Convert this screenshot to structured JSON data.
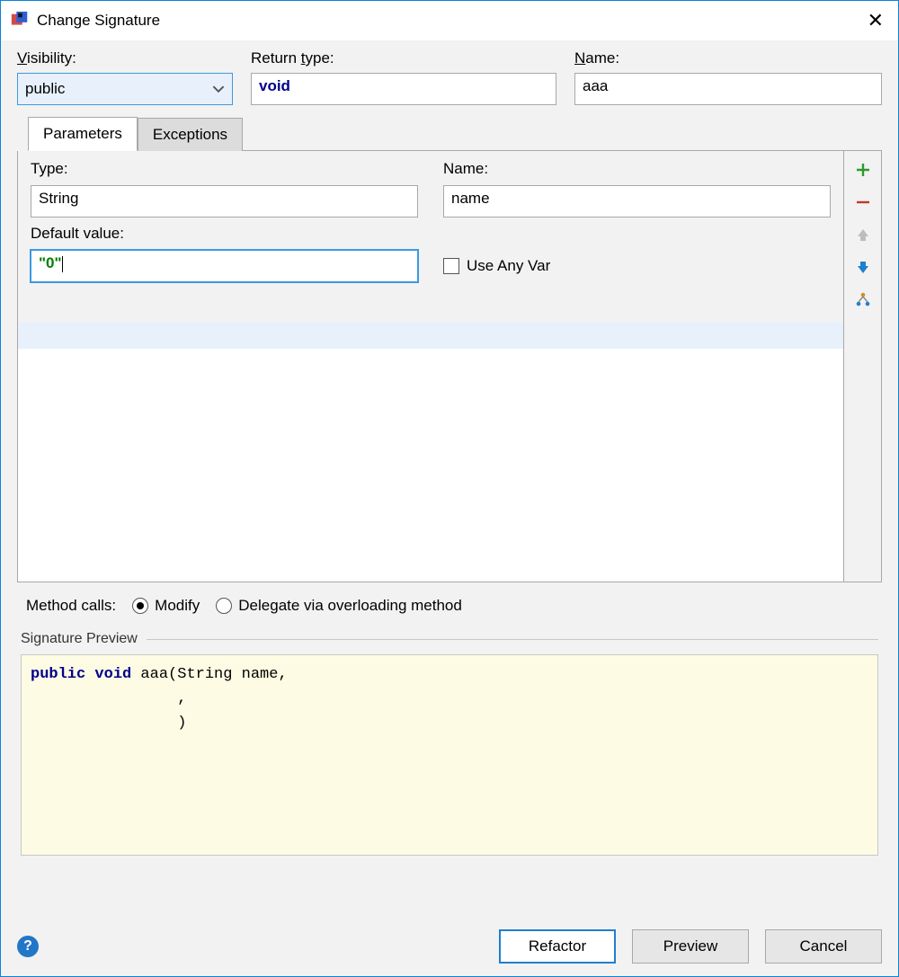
{
  "window": {
    "title": "Change Signature"
  },
  "fields": {
    "visibility": {
      "label": "Visibility:",
      "value": "public"
    },
    "returnType": {
      "label": "Return type:",
      "value": "void"
    },
    "name": {
      "label": "Name:",
      "value": "aaa"
    }
  },
  "tabs": {
    "parameters": "Parameters",
    "exceptions": "Exceptions"
  },
  "paramForm": {
    "typeLabel": "Type:",
    "typeValue": "String",
    "nameLabel": "Name:",
    "nameValue": "name",
    "defaultLabel": "Default value:",
    "defaultValue": "\"0\"",
    "useAnyVar": "Use Any Var"
  },
  "methodCalls": {
    "label": "Method calls:",
    "modify": "Modify",
    "delegate": "Delegate via overloading method"
  },
  "sigPreview": {
    "label": "Signature Preview",
    "kw1": "public",
    "kw2": "void",
    "line1_rest": " aaa(String name,",
    "line2": "                ,",
    "line3": "                )"
  },
  "buttons": {
    "refactor": "Refactor",
    "preview": "Preview",
    "cancel": "Cancel"
  }
}
